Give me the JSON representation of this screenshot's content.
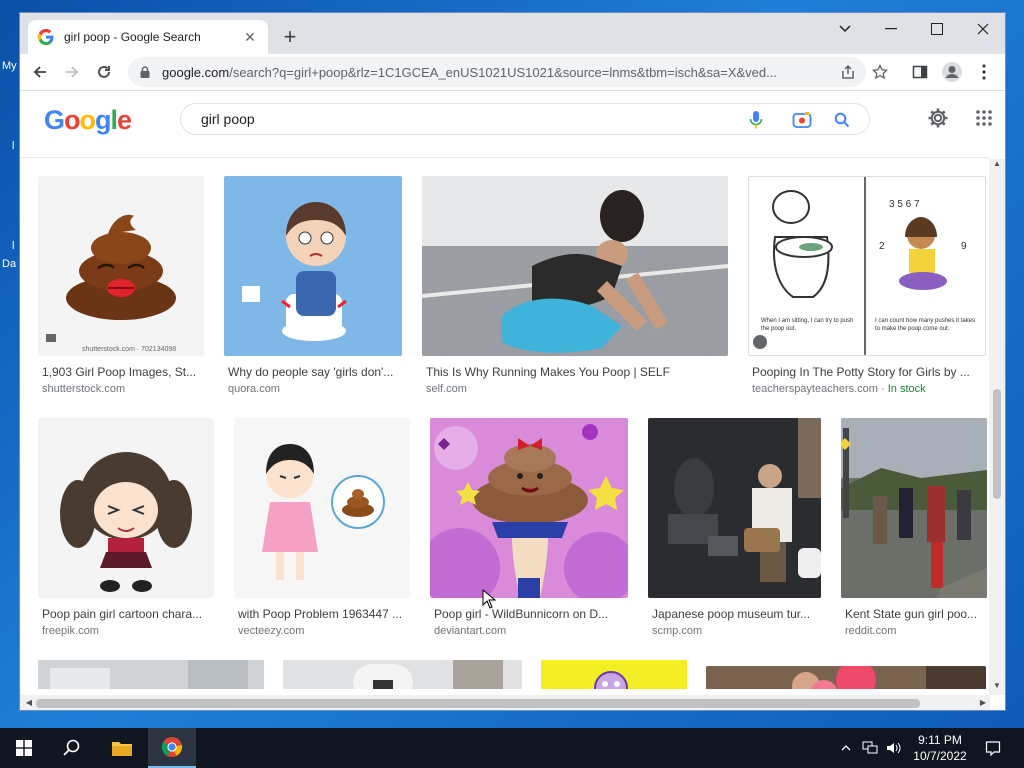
{
  "desktop": {
    "fragments": [
      "My",
      "l",
      "l",
      "Da"
    ]
  },
  "browser": {
    "tab_title": "girl poop - Google Search",
    "tab_close": "✕",
    "new_tab": "+",
    "url_domain": "google.com",
    "url_rest": "/search?q=girl+poop&rlz=1C1GCEA_enUS1021US1021&source=lnms&tbm=isch&sa=X&ved...",
    "window_controls": [
      "chevron-down",
      "minimize",
      "maximize",
      "close"
    ]
  },
  "google": {
    "logo_letters": [
      "G",
      "o",
      "o",
      "g",
      "l",
      "e"
    ],
    "logo_colors": [
      "#4285f4",
      "#ea4335",
      "#fbbc05",
      "#4285f4",
      "#34a853",
      "#ea4335"
    ],
    "search_value": "girl poop"
  },
  "results": [
    {
      "title": "1,903 Girl Poop Images, St...",
      "source": "shutterstock.com",
      "thumb_text": "shutterstock.com · 702134098"
    },
    {
      "title": "Why do people say 'girls don'...",
      "source": "quora.com"
    },
    {
      "title": "This Is Why Running Makes You Poop | SELF",
      "source": "self.com"
    },
    {
      "title": "Pooping In The Potty Story for Girls by ...",
      "source": "teacherspayteachers.com",
      "badge": "In stock",
      "thumb_text_a": "When I am sitting, I can try to push the poop out.",
      "thumb_text_b": "I can count how many pushes it takes to make the poop come out."
    },
    {
      "title": "Poop pain girl cartoon chara...",
      "source": "freepik.com"
    },
    {
      "title": "with Poop Problem 1963447 ...",
      "source": "vecteezy.com"
    },
    {
      "title": "Poop girl - WildBunnicorn on D...",
      "source": "deviantart.com"
    },
    {
      "title": "Japanese poop museum tur...",
      "source": "scmp.com"
    },
    {
      "title": "Kent State gun girl poo...",
      "source": "reddit.com"
    }
  ],
  "taskbar": {
    "time": "9:11 PM",
    "date": "10/7/2022"
  }
}
